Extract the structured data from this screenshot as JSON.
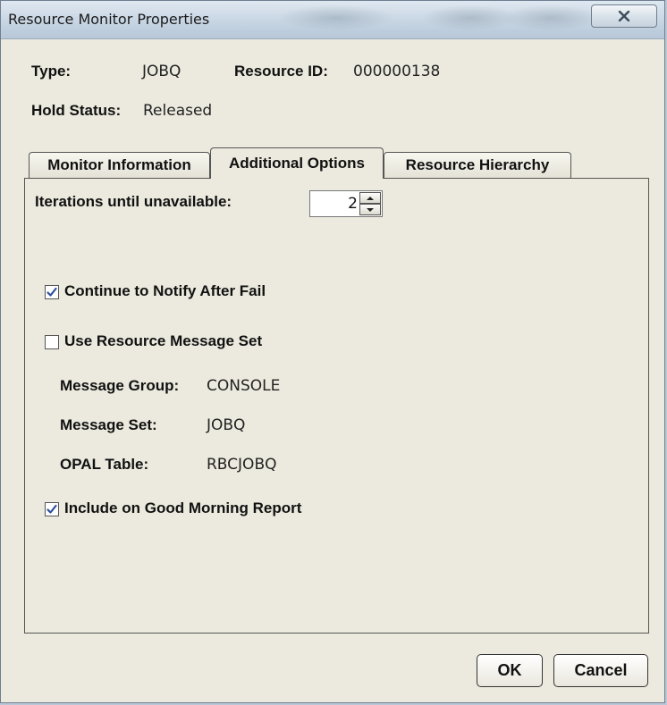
{
  "window": {
    "title": "Resource Monitor Properties"
  },
  "header": {
    "type_label": "Type:",
    "type_value": "JOBQ",
    "resource_id_label": "Resource ID:",
    "resource_id_value": "000000138",
    "hold_status_label": "Hold Status:",
    "hold_status_value": "Released"
  },
  "tabs": [
    {
      "label": "Monitor Information",
      "active": false
    },
    {
      "label": "Additional Options",
      "active": true
    },
    {
      "label": "Resource Hierarchy",
      "active": false
    }
  ],
  "additional_options": {
    "iterations_label": "Iterations until unavailable:",
    "iterations_value": "2",
    "continue_notify_label": "Continue to Notify After Fail",
    "continue_notify_checked": true,
    "use_message_set_label": "Use Resource Message Set",
    "use_message_set_checked": false,
    "message_group_label": "Message Group:",
    "message_group_value": "CONSOLE",
    "message_set_label": "Message Set:",
    "message_set_value": "JOBQ",
    "opal_table_label": "OPAL Table:",
    "opal_table_value": "RBCJOBQ",
    "good_morning_label": "Include on Good Morning Report",
    "good_morning_checked": true
  },
  "buttons": {
    "ok": "OK",
    "cancel": "Cancel"
  },
  "icons": {
    "close": "close-icon",
    "spin_up": "arrow-up-icon",
    "spin_down": "arrow-down-icon",
    "check": "checkmark-icon"
  },
  "colors": {
    "dialog_bg": "#eceade",
    "titlebar": "#c7d5e3",
    "check_blue": "#2a4f9c"
  }
}
